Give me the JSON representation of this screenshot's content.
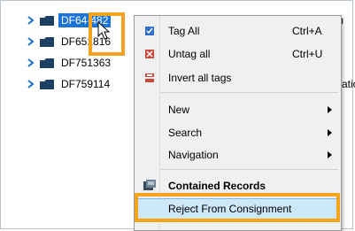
{
  "tree": {
    "items": [
      {
        "label": "DF64-482",
        "selected": true
      },
      {
        "label": "DF651816",
        "selected": false
      },
      {
        "label": "DF751363",
        "selected": false
      },
      {
        "label": "DF759114",
        "selected": false
      }
    ],
    "truncated_right_1": "m",
    "truncated_right_4": "atio"
  },
  "menu": {
    "tag_all": {
      "label": "Tag All",
      "shortcut": "Ctrl+A"
    },
    "untag_all": {
      "label": "Untag all",
      "shortcut": "Ctrl+U"
    },
    "invert_tags": {
      "label": "Invert all tags"
    },
    "new": {
      "label": "New"
    },
    "search": {
      "label": "Search"
    },
    "navigation": {
      "label": "Navigation"
    },
    "contained_records": {
      "label": "Contained Records"
    },
    "reject_consignment": {
      "label": "Reject From Consignment"
    }
  },
  "colors": {
    "selection": "#1b74d6",
    "annotation": "#f5a21c",
    "menu_highlight": "#cde8fb"
  }
}
